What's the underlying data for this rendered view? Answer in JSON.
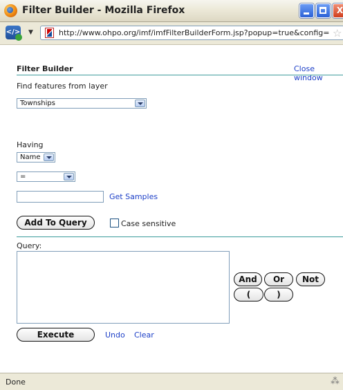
{
  "window": {
    "title": "Filter Builder - Mozilla Firefox",
    "minimize_glyph": "",
    "maximize_glyph": "",
    "close_glyph": "X"
  },
  "navbar": {
    "url": "http://www.ohpo.org/imf/imfFilterBuilderForm.jsp?popup=true&config=",
    "icons": [
      "firefox-icon",
      "site-identity-icon",
      "dropdown-arrow-icon",
      "ohio-flag-favicon",
      "bookmark-star-icon"
    ]
  },
  "form": {
    "heading": "Filter Builder",
    "close_link": "Close window",
    "find_label": "Find features from layer",
    "layer_select": "Townships",
    "having_label": "Having",
    "field_select": "Name",
    "operator_select": "=",
    "value_input": "",
    "get_samples": "Get Samples",
    "add_to_query": "Add To Query",
    "case_sensitive": "Case sensitive",
    "case_sensitive_checked": false,
    "query_label": "Query:",
    "query_text": "",
    "operators": {
      "and": "And",
      "or": "Or",
      "not": "Not",
      "open_paren": "(",
      "close_paren": ")"
    },
    "execute": "Execute",
    "undo": "Undo",
    "clear": "Clear"
  },
  "status": {
    "text": "Done"
  }
}
